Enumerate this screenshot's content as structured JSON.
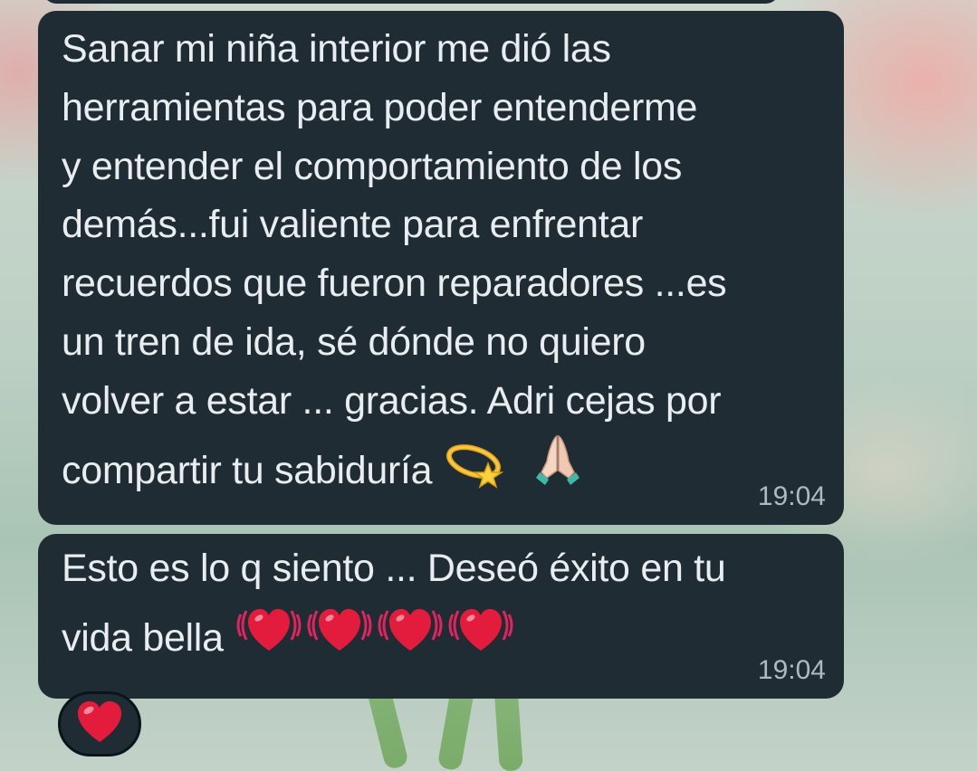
{
  "messages": [
    {
      "text": "Sanar mi niña interior me dió las\nherramientas para poder entenderme\ny entender el comportamiento de los\ndemás...fui valiente para enfrentar\nrecuerdos que fueron reparadores ...es\nun tren de ida, sé dónde no quiero\nvolver a estar ... gracias. Adri cejas por\ncompartir tu sabiduría",
      "emojis": [
        "dizzy-emoji",
        "folded-hands-emoji"
      ],
      "time": "19:04"
    },
    {
      "text": "Esto es lo q siento ... Deseó éxito en tu\nvida bella",
      "emojis": [
        "beating-heart-emoji",
        "beating-heart-emoji",
        "beating-heart-emoji",
        "beating-heart-emoji"
      ],
      "time": "19:04"
    }
  ],
  "reaction": {
    "emoji": "red-heart-emoji"
  },
  "colors": {
    "bubble": "#1f2c34",
    "text": "#e9edef",
    "time": "#aebac1"
  }
}
